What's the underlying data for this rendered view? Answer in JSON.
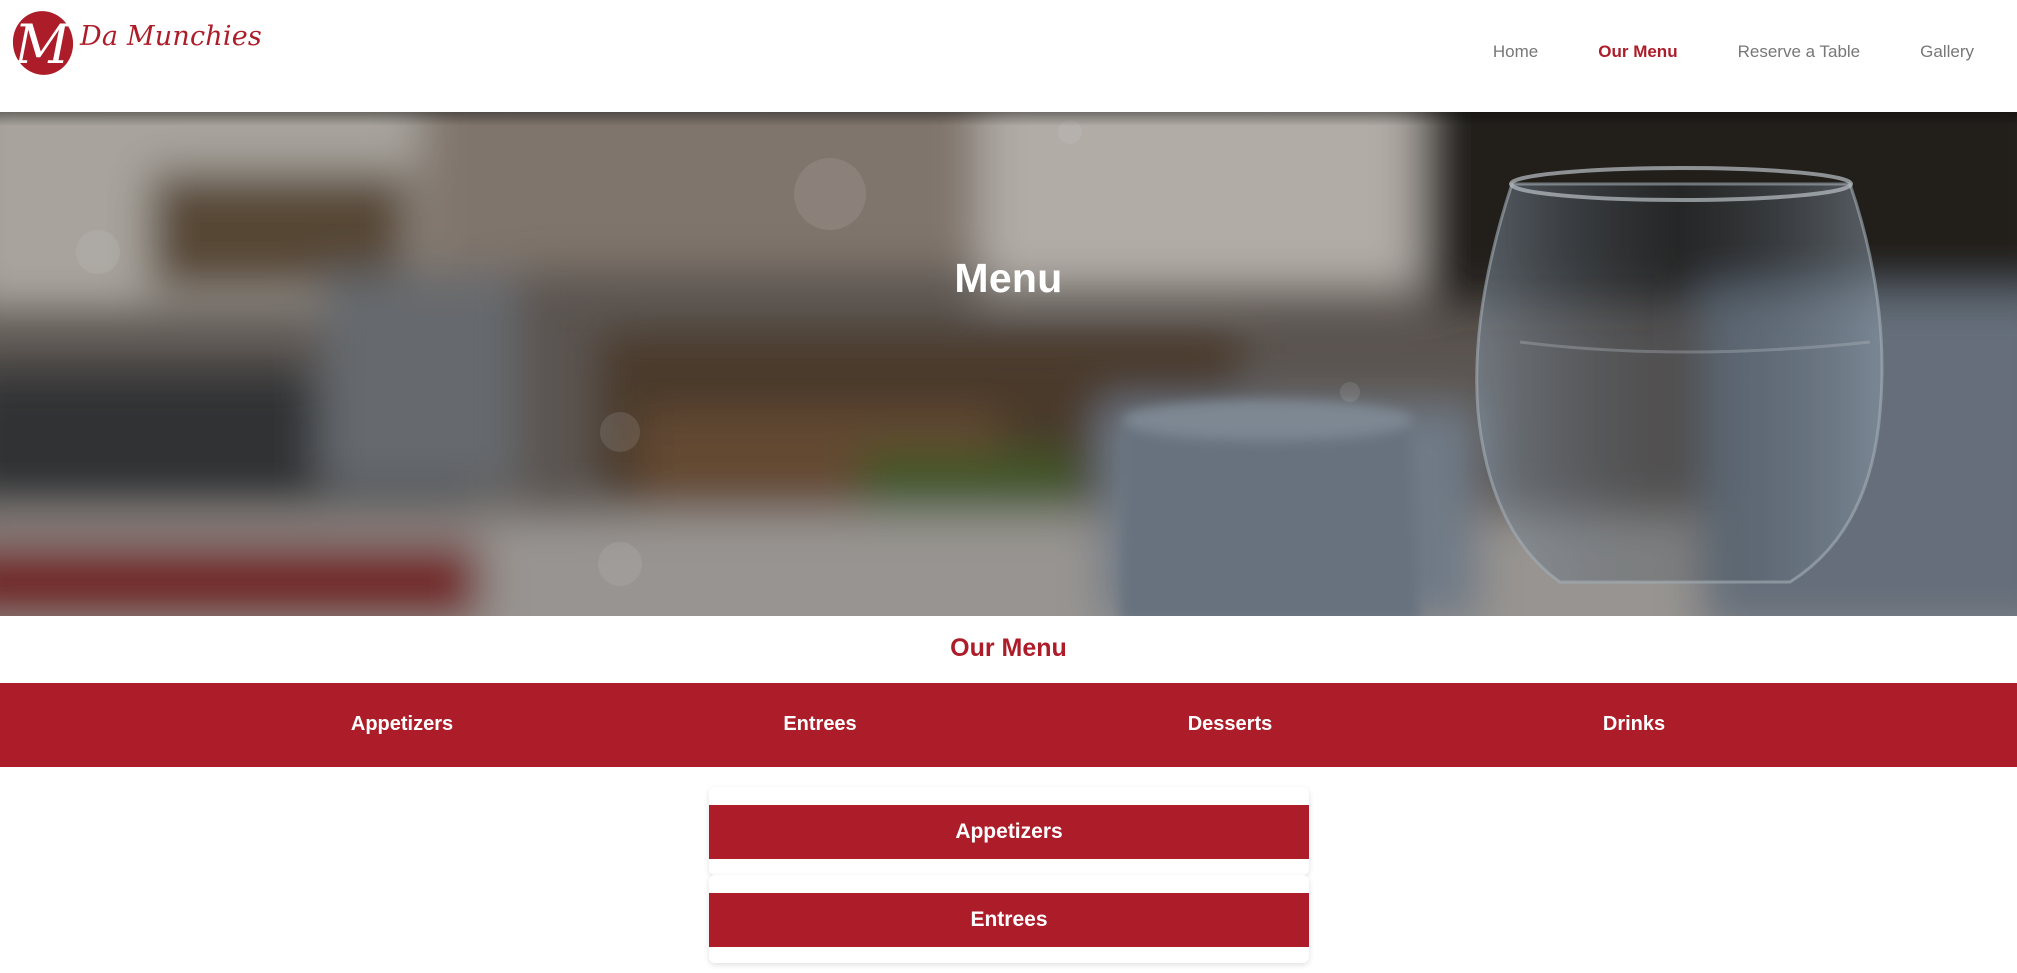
{
  "brand": {
    "logo_letter": "M",
    "name": "Da Munchies"
  },
  "nav": {
    "home": "Home",
    "our_menu": "Our Menu",
    "reserve": "Reserve a Table",
    "gallery": "Gallery",
    "active": "Our Menu"
  },
  "hero": {
    "title": "Menu"
  },
  "section": {
    "title": "Our Menu"
  },
  "categories": [
    "Appetizers",
    "Entrees",
    "Desserts",
    "Drinks"
  ],
  "cards": [
    "Appetizers",
    "Entrees"
  ],
  "colors": {
    "brand_red": "#ad1d29",
    "nav_gray": "#777777",
    "white": "#ffffff"
  }
}
